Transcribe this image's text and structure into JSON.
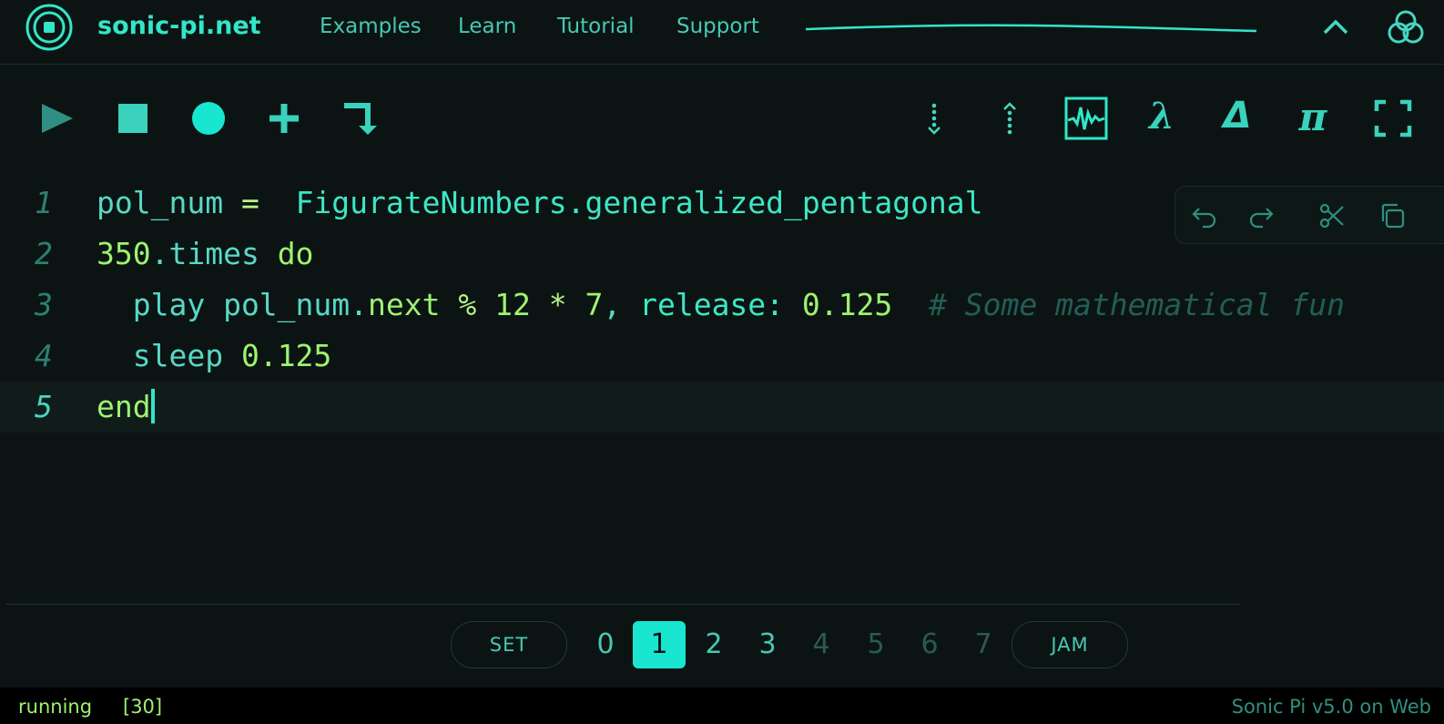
{
  "header": {
    "brand": "sonic-pi.net",
    "nav": [
      "Examples",
      "Learn",
      "Tutorial",
      "Support"
    ],
    "icons": [
      "sonic-pi-logo-icon",
      "chevron-up-icon",
      "user-circles-icon"
    ]
  },
  "toolbar": {
    "left_icons": [
      "play-icon",
      "stop-icon",
      "record-icon",
      "new-buffer-icon",
      "run-selection-icon"
    ],
    "right_icons": [
      "scroll-down-icon",
      "scroll-up-icon",
      "scope-icon",
      "lambda-icon",
      "delta-icon",
      "pi-icon",
      "fullscreen-icon"
    ],
    "lambda": "λ",
    "delta": "Δ",
    "pi": "π"
  },
  "editor": {
    "lines": [
      {
        "num": "1",
        "tokens": [
          [
            "id",
            "pol_num"
          ],
          [
            "op",
            " =  "
          ],
          [
            "sym",
            "FigurateNumbers.generalized_pentagonal"
          ]
        ]
      },
      {
        "num": "2",
        "tokens": [
          [
            "num",
            "350"
          ],
          [
            "id",
            ".times "
          ],
          [
            "kw",
            "do"
          ]
        ]
      },
      {
        "num": "3",
        "tokens": [
          [
            "id",
            "  play pol_num."
          ],
          [
            "kw",
            "next"
          ],
          [
            "op",
            " % "
          ],
          [
            "num",
            "12"
          ],
          [
            "op",
            " * "
          ],
          [
            "num",
            "7"
          ],
          [
            "id",
            ", "
          ],
          [
            "sym",
            "release:"
          ],
          [
            "op",
            " "
          ],
          [
            "num",
            "0.125"
          ],
          [
            "op",
            "  "
          ],
          [
            "comment",
            "# Some mathematical fun"
          ]
        ]
      },
      {
        "num": "4",
        "tokens": [
          [
            "id",
            "  sleep "
          ],
          [
            "num",
            "0.125"
          ]
        ]
      },
      {
        "num": "5",
        "tokens": [
          [
            "kw",
            "end"
          ]
        ]
      }
    ],
    "active_line": 5
  },
  "edit_toolbar": [
    "undo-icon",
    "redo-icon",
    "cut-icon",
    "copy-icon"
  ],
  "buffers": {
    "set_label": "SET",
    "jam_label": "JAM",
    "items": [
      "0",
      "1",
      "2",
      "3",
      "4",
      "5",
      "6",
      "7"
    ],
    "selected": "1",
    "used": [
      "0",
      "1",
      "2",
      "3"
    ]
  },
  "status": {
    "state": "running",
    "count": "[30]",
    "version": "Sonic Pi v5.0 on Web"
  },
  "colors": {
    "accent": "#32e6c8",
    "background": "#0b1413"
  }
}
